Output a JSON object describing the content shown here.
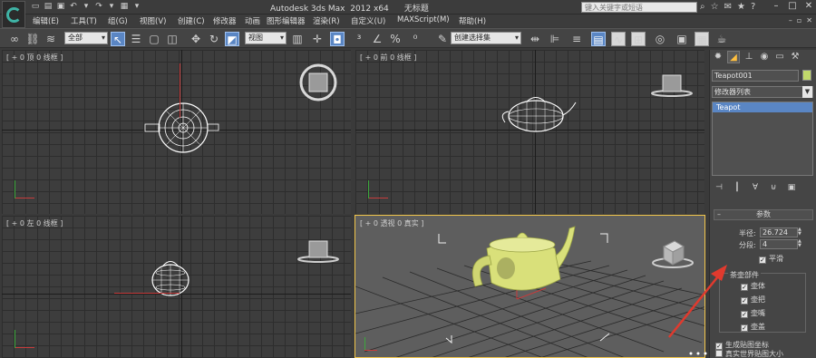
{
  "titlebar": {
    "title": "Autodesk 3ds Max  2012 x64      无标题",
    "search_placeholder": "键入关键字或短语"
  },
  "menu": {
    "items": [
      "编辑(E)",
      "工具(T)",
      "组(G)",
      "视图(V)",
      "创建(C)",
      "修改器",
      "动画",
      "图形编辑器",
      "渲染(R)",
      "自定义(U)",
      "MAXScript(M)",
      "帮助(H)"
    ]
  },
  "toolbar": {
    "selection_filter": "全部",
    "ref_coord": "视图",
    "named_selection": "创建选择集"
  },
  "viewports": {
    "top": "[ + 0 顶 0 线框 ]",
    "front": "[ + 0 前 0 线框 ]",
    "left": "[ + 0 左 0 线框 ]",
    "perspective": "[ + 0 透视 0 真实 ]"
  },
  "command_panel": {
    "object_name": "Teapot001",
    "object_color": "#c1d96b",
    "modifier_list": "修改器列表",
    "stack_item": "Teapot",
    "params_title": "参数",
    "radius_label": "半径:",
    "radius_value": "26.724",
    "segments_label": "分段:",
    "segments_value": "4",
    "smooth_label": "平滑",
    "parts_label": "茶壶部件",
    "body_label": "壶体",
    "handle_label": "壶把",
    "spout_label": "壶嘴",
    "lid_label": "壶盖",
    "gen_coords_label": "生成贴图坐标",
    "real_world_label": "真实世界贴图大小"
  },
  "colors": {
    "accent": "#5a86c4",
    "active_viewport_border": "#f2c64b",
    "teapot": "#d9e07a",
    "annotation_arrow": "#e03a2e"
  }
}
